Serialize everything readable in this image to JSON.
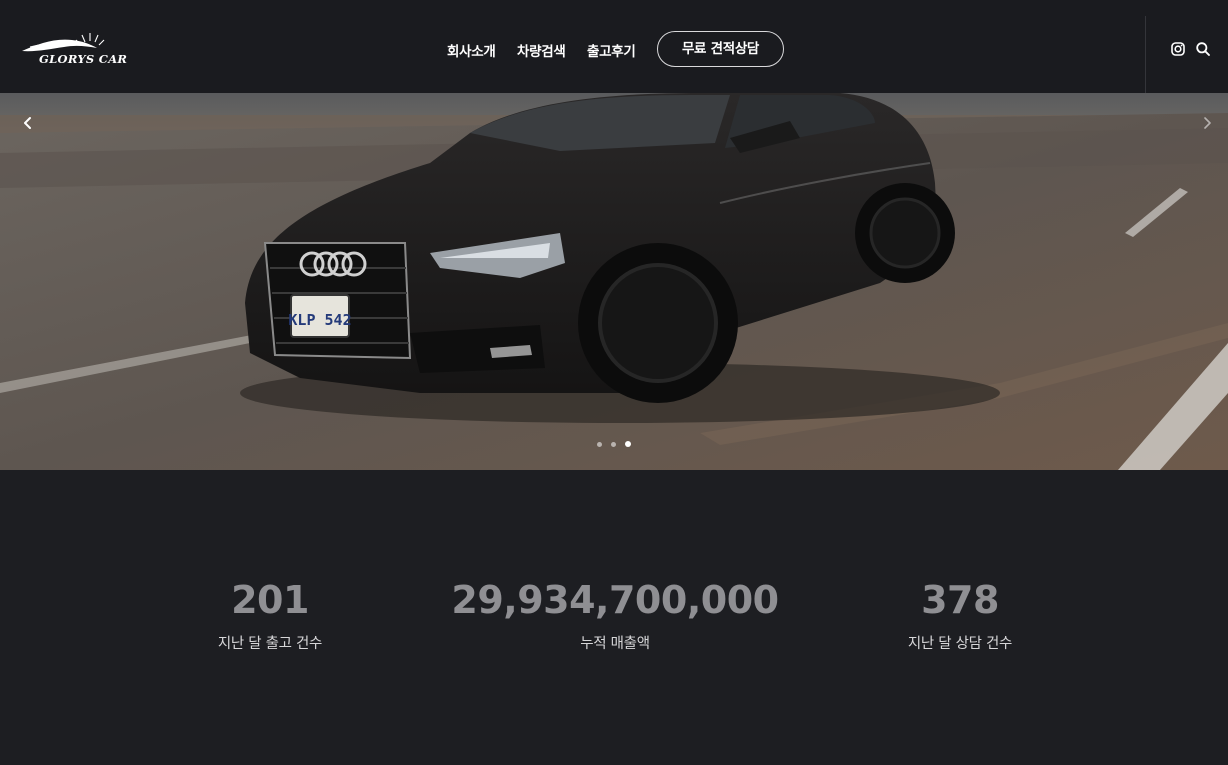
{
  "header": {
    "logo_text": "GLORYS CAR",
    "nav": {
      "about": "회사소개",
      "vehicle_search": "차량검색",
      "delivery_reviews": "출고후기"
    },
    "quote_button": "무료 견적상담",
    "icons": [
      "instagram-icon",
      "search-icon"
    ]
  },
  "hero": {
    "slides_total": 3,
    "active_slide": 3,
    "plate_text": "KLP 542",
    "icons": [
      "chevron-left-icon",
      "chevron-right-icon"
    ]
  },
  "stats": [
    {
      "value": "201",
      "label": "지난 달 출고 건수"
    },
    {
      "value": "29,934,700,000",
      "label": "누적 매출액"
    },
    {
      "value": "378",
      "label": "지난 달 상담 건수"
    }
  ],
  "colors": {
    "header_bg": "#1a1b1f",
    "page_bg": "#1d1e22",
    "stat_value": "#8f8f93",
    "stat_label": "#d6d6d8"
  }
}
